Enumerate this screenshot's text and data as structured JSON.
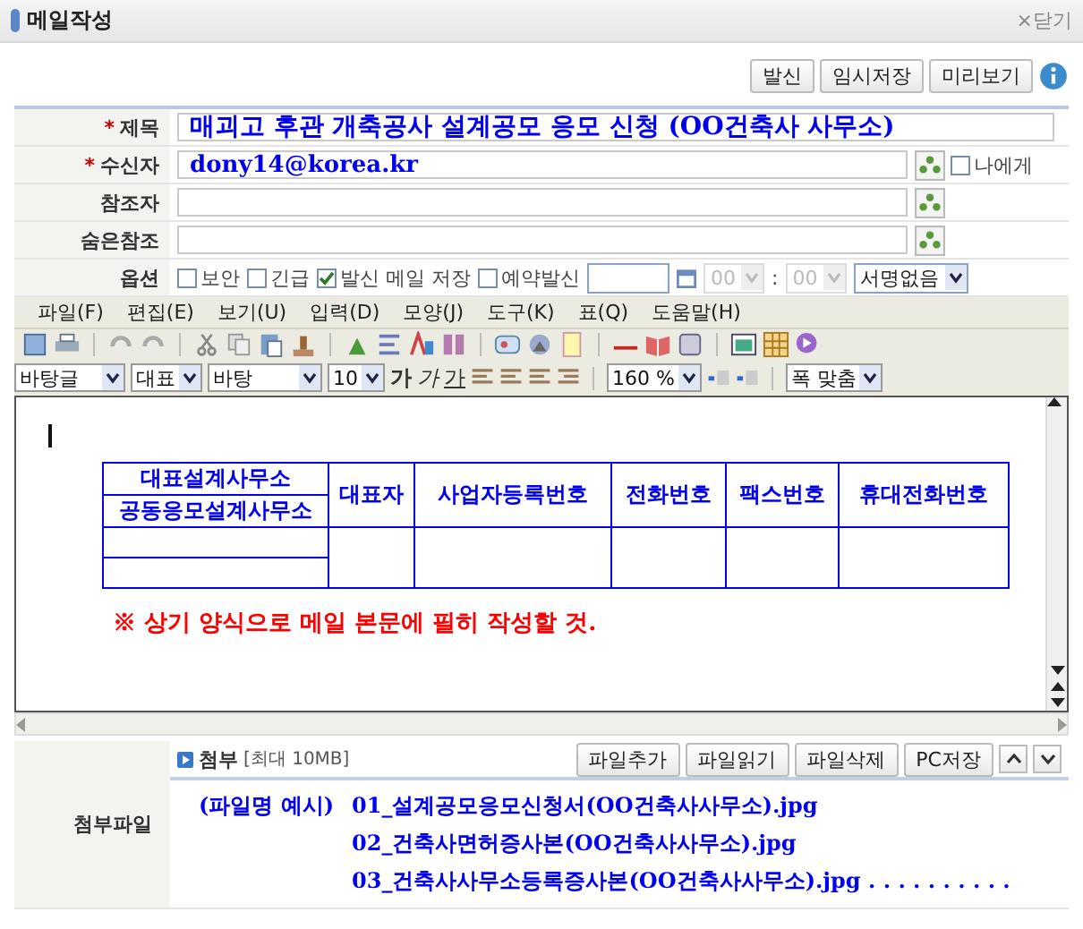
{
  "window": {
    "title": "메일작성",
    "close": "×닫기"
  },
  "actions": [
    "발신",
    "임시저장",
    "미리보기"
  ],
  "fields": [
    {
      "label": "제목",
      "mark": "*",
      "value": "매괴고 후관 개축공사 설계공모 응모 신청 (OO건축사 사무소)",
      "kind": "subject"
    },
    {
      "label": "수신자",
      "mark": "*",
      "value": "dony14@korea.kr",
      "kind": "address",
      "self_option": {
        "label": "나에게",
        "checked": false
      }
    },
    {
      "label": "참조자",
      "kind": "address"
    },
    {
      "label": "숨은참조",
      "kind": "address"
    }
  ],
  "options": {
    "label": "옵션",
    "checkboxes": [
      {
        "label": "보안",
        "checked": false
      },
      {
        "label": "긴급",
        "checked": false
      },
      {
        "label": "발신 메일 저장",
        "checked": true
      },
      {
        "label": "예약발신",
        "checked": false
      }
    ],
    "time": {
      "hour": "00",
      "separator": ":",
      "minute": "00",
      "disabled": true
    },
    "signature": "서명없음"
  },
  "menu": [
    "파일(F)",
    "편집(E)",
    "보기(U)",
    "입력(D)",
    "모양(J)",
    "도구(K)",
    "표(Q)",
    "도움말(H)"
  ],
  "format": {
    "style": "바탕글",
    "lang": "대표",
    "font": "바탕",
    "size": "10",
    "bold": "가",
    "italic": "가",
    "underline": "가",
    "zoom": "160 %",
    "fit": "폭 맞춤"
  },
  "document": {
    "table": {
      "first_column": [
        "대표설계사무소",
        "공동응모설계사무소"
      ],
      "columns": [
        "대표자",
        "사업자등록번호",
        "전화번호",
        "팩스번호",
        "휴대전화번호"
      ]
    },
    "note": "※ 상기 양식으로 메일 본문에 필히 작성할 것."
  },
  "attachments": {
    "label": "첨부파일",
    "title": "첨부",
    "limit": "[최대 10MB]",
    "buttons": [
      "파일추가",
      "파일읽기",
      "파일삭제",
      "PC저장"
    ],
    "example_label": "(파일명 예시)",
    "files": [
      "01_설계공모응모신청서(OO건축사사무소).jpg",
      "02_건축사면허증사본(OO건축사사무소).jpg",
      "03_건축사사무소등록증사본(OO건축사사무소).jpg . . . . . . . . . ."
    ]
  }
}
